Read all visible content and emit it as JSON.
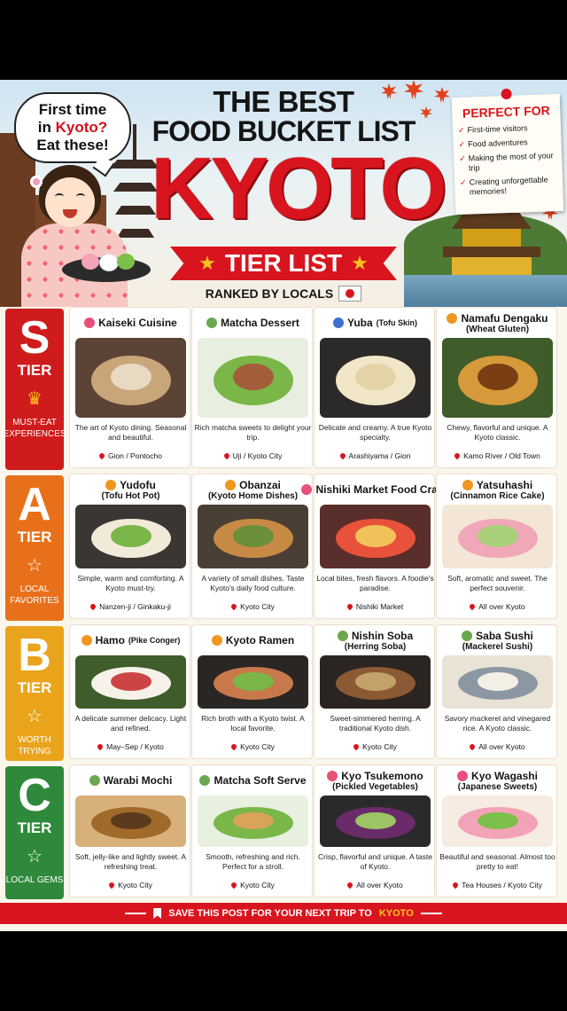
{
  "header": {
    "speech": [
      "First time",
      "in",
      "Kyoto?",
      "Eat these!"
    ],
    "title_line1": "THE BEST",
    "title_line2": "FOOD BUCKET LIST",
    "title_kyoto": "KYOTO",
    "banner": "TIER LIST",
    "ranked": "RANKED BY LOCALS"
  },
  "perfect_for": {
    "title": "PERFECT FOR",
    "items": [
      "First-time visitors",
      "Food adventures",
      "Making the most of your trip",
      "Creating unforgettable memories!"
    ]
  },
  "tiers": [
    {
      "letter": "S",
      "word": "TIER",
      "sub": "MUST-EAT EXPERIENCES",
      "color": "#cf1b1b",
      "icon": "crown-icon",
      "foods": [
        {
          "name": "Kaiseki Cuisine",
          "sub": "",
          "desc": "The art of Kyoto dining. Seasonal and beautiful.",
          "loc": "Gion / Pontocho",
          "flower": "#e8517a"
        },
        {
          "name": "Matcha Dessert",
          "sub": "",
          "desc": "Rich matcha sweets to delight your trip.",
          "loc": "Uji / Kyoto City",
          "flower": "#6aa84f"
        },
        {
          "name": "Yuba",
          "sub": "(Tofu Skin)",
          "desc": "Delicate and creamy. A true Kyoto specialty.",
          "loc": "Arashiyama / Gion",
          "flower": "#3d6fd1"
        },
        {
          "name": "Namafu Dengaku",
          "sub": "(Wheat Gluten)",
          "desc": "Chewy, flavorful and unique. A Kyoto classic.",
          "loc": "Kamo River / Old Town",
          "flower": "#f0961e"
        }
      ]
    },
    {
      "letter": "A",
      "word": "TIER",
      "sub": "LOCAL FAVORITES",
      "color": "#e8701a",
      "icon": "star-outline-icon",
      "foods": [
        {
          "name": "Yudofu",
          "sub": "(Tofu Hot Pot)",
          "desc": "Simple, warm and comforting. A Kyoto must-try.",
          "loc": "Nanzen-ji / Ginkaku-ji",
          "flower": "#f0961e"
        },
        {
          "name": "Obanzai",
          "sub": "(Kyoto Home Dishes)",
          "desc": "A variety of small dishes. Taste Kyoto's daily food culture.",
          "loc": "Kyoto City",
          "flower": "#f0961e"
        },
        {
          "name": "Nishiki Market Food Crawl",
          "sub": "",
          "desc": "Local bites, fresh flavors. A foodie's paradise.",
          "loc": "Nishiki Market",
          "flower": "#e8517a"
        },
        {
          "name": "Yatsuhashi",
          "sub": "(Cinnamon Rice Cake)",
          "desc": "Soft, aromatic and sweet. The perfect souvenir.",
          "loc": "All over Kyoto",
          "flower": "#f0961e"
        }
      ]
    },
    {
      "letter": "B",
      "word": "TIER",
      "sub": "WORTH TRYING",
      "color": "#e9a41b",
      "icon": "star-outline-icon",
      "foods": [
        {
          "name": "Hamo",
          "sub": "(Pike Conger)",
          "desc": "A delicate summer delicacy. Light and refined.",
          "loc": "May–Sep / Kyoto",
          "flower": "#f0961e"
        },
        {
          "name": "Kyoto Ramen",
          "sub": "",
          "desc": "Rich broth with a Kyoto twist. A local favorite.",
          "loc": "Kyoto City",
          "flower": "#f0961e"
        },
        {
          "name": "Nishin Soba",
          "sub": "(Herring Soba)",
          "desc": "Sweet-simmered herring. A traditional Kyoto dish.",
          "loc": "Kyoto City",
          "flower": "#6aa84f"
        },
        {
          "name": "Saba Sushi",
          "sub": "(Mackerel Sushi)",
          "desc": "Savory mackerel and vinegared rice. A Kyoto classic.",
          "loc": "All over Kyoto",
          "flower": "#6aa84f"
        }
      ]
    },
    {
      "letter": "C",
      "word": "TIER",
      "sub": "LOCAL GEMS",
      "color": "#2e8a3a",
      "icon": "star-outline-icon",
      "foods": [
        {
          "name": "Warabi Mochi",
          "sub": "",
          "desc": "Soft, jelly-like and lightly sweet. A refreshing treat.",
          "loc": "Kyoto City",
          "flower": "#6aa84f"
        },
        {
          "name": "Matcha Soft Serve",
          "sub": "",
          "desc": "Smooth, refreshing and rich. Perfect for a stroll.",
          "loc": "Kyoto City",
          "flower": "#6aa84f"
        },
        {
          "name": "Kyo Tsukemono",
          "sub": "(Pickled Vegetables)",
          "desc": "Crisp, flavorful and unique. A taste of Kyoto.",
          "loc": "All over Kyoto",
          "flower": "#e8517a"
        },
        {
          "name": "Kyo Wagashi",
          "sub": "(Japanese Sweets)",
          "desc": "Beautiful and seasonal. Almost too pretty to eat!",
          "loc": "Tea Houses / Kyoto City",
          "flower": "#e8517a"
        }
      ]
    }
  ],
  "footer": {
    "text": "SAVE THIS POST FOR YOUR  NEXT TRIP TO",
    "highlight": "KYOTO"
  }
}
